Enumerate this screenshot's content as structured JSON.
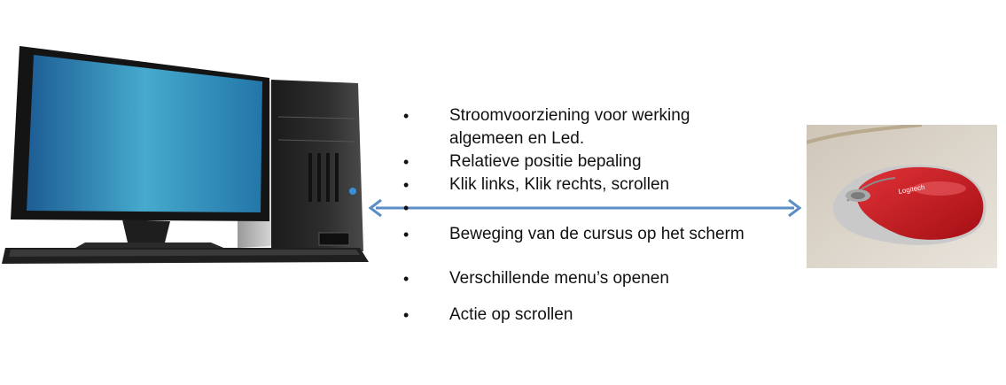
{
  "icons": {
    "computer": "desktop-computer-icon",
    "mouse": "computer-mouse-icon",
    "arrow": "double-headed-arrow-icon"
  },
  "colors": {
    "arrow": "#5b8ec4",
    "screen": "#3fa0c8",
    "mouse_body": "#c5161c"
  },
  "mouse_label": "Logitech",
  "bullet_char": "•",
  "bullets": [
    {
      "text": "Stroomvoorziening voor werking algemeen en Led."
    },
    {
      "text": "Relatieve positie bepaling"
    },
    {
      "text": "Klik links, Klik rechts, scrollen"
    },
    {
      "text": ""
    },
    {
      "text": "Beweging van de cursus op het scherm"
    },
    {
      "text": "Verschillende menu’s openen"
    },
    {
      "text": "Actie op scrollen"
    }
  ]
}
